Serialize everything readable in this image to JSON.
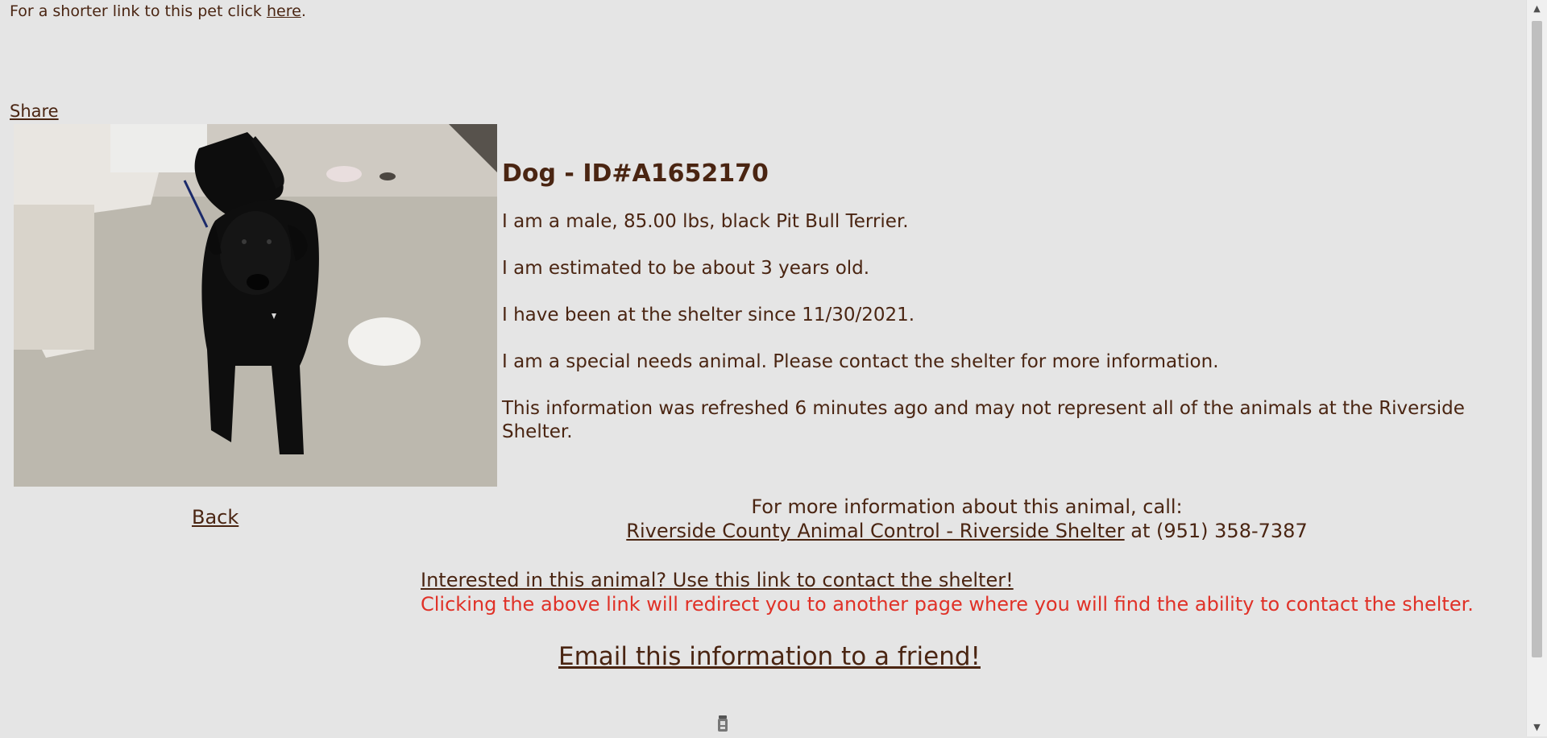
{
  "top": {
    "shorter_link_prefix": "For a shorter link to this pet click ",
    "shorter_link_label": "here",
    "shorter_link_suffix": "."
  },
  "share_label": "Share",
  "pet": {
    "heading": "Dog - ID#A1652170",
    "description": "I am a male, 85.00 lbs, black Pit Bull Terrier.",
    "age": "I am estimated to be about 3 years old.",
    "since": "I have been at the shelter since 11/30/2021.",
    "special_needs": "I am a special needs animal. Please contact the shelter for more information.",
    "refresh_note": "This information was refreshed 6 minutes ago and may not represent all of the animals at the Riverside Shelter."
  },
  "back_label": "Back",
  "contact": {
    "call_text": "For more information about this animal, call:",
    "shelter_link": "Riverside County Animal Control - Riverside Shelter",
    "phone_text": " at (951) 358-7387"
  },
  "interest": {
    "link_label": "Interested in this animal? Use this link to contact the shelter!",
    "redirect_note": "Clicking the above link will redirect you to another page where you will find the ability to contact the shelter."
  },
  "email_label": "Email this information to a friend!",
  "colors": {
    "background": "#e5e5e5",
    "text": "#4a2512",
    "warning": "#e03127"
  },
  "icons": {
    "scroll_up": "scroll-up-arrow-icon",
    "scroll_down": "scroll-down-arrow-icon",
    "loader": "loading-spinner-icon"
  }
}
